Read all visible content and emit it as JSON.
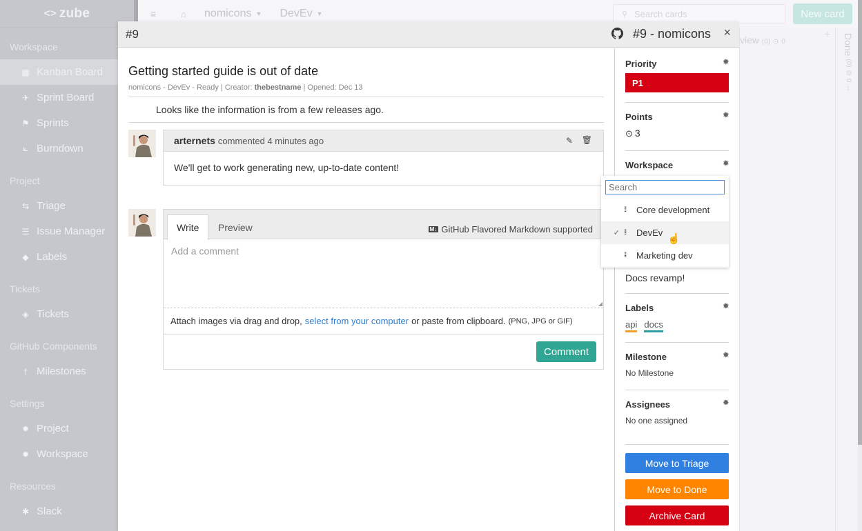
{
  "app": {
    "logo": "zube",
    "logo_icon": "code-brackets-icon"
  },
  "sidebar": {
    "sections": [
      {
        "title": "Workspace",
        "items": [
          {
            "label": "Kanban Board",
            "icon": "kanban-icon",
            "active": true
          },
          {
            "label": "Sprint Board",
            "icon": "runner-icon"
          },
          {
            "label": "Sprints",
            "icon": "flag-icon"
          },
          {
            "label": "Burndown",
            "icon": "chart-icon"
          }
        ]
      },
      {
        "title": "Project",
        "items": [
          {
            "label": "Triage",
            "icon": "triage-icon"
          },
          {
            "label": "Issue Manager",
            "icon": "list-icon"
          },
          {
            "label": "Labels",
            "icon": "tag-icon"
          }
        ]
      },
      {
        "title": "Tickets",
        "items": [
          {
            "label": "Tickets",
            "icon": "ticket-icon"
          }
        ]
      },
      {
        "title": "GitHub Components",
        "items": [
          {
            "label": "Milestones",
            "icon": "milestone-icon"
          }
        ]
      },
      {
        "title": "Settings",
        "items": [
          {
            "label": "Project",
            "icon": "gear-icon"
          },
          {
            "label": "Workspace",
            "icon": "gear-icon"
          }
        ]
      },
      {
        "title": "Resources",
        "items": [
          {
            "label": "Slack",
            "icon": "slack-icon"
          }
        ]
      }
    ]
  },
  "topbar": {
    "project": "nomicons",
    "workspace": "DevEv",
    "search_placeholder": "Search cards",
    "new_card": "New card"
  },
  "board": {
    "review_col": {
      "title": "view",
      "count": "(0)",
      "points": "0"
    },
    "done_col": {
      "title": "Done",
      "count": "(0)",
      "points": "0"
    }
  },
  "modal": {
    "id_label": "#9",
    "github_title": "#9 - nomicons",
    "close": "×",
    "card_title": "Getting started guide is out of date",
    "meta_prefix": "nomicons - DevEv - Ready | Creator: ",
    "meta_creator": "thebestname",
    "meta_suffix": " | Opened: Dec 13",
    "description": "Looks like the information is from a few releases ago.",
    "comment": {
      "author": "arternets",
      "action": "commented 4 minutes ago",
      "body": "We'll get to work generating new, up-to-date content!"
    },
    "new_comment": {
      "tab_write": "Write",
      "tab_preview": "Preview",
      "markdown_badge": "M↓",
      "markdown_note": "GitHub Flavored Markdown supported",
      "placeholder": "Add a comment",
      "attach_prefix": "Attach images via drag and drop,",
      "attach_link": "select from your computer",
      "attach_suffix": "or paste from clipboard.",
      "attach_types": "(PNG, JPG or GIF)",
      "submit": "Comment"
    }
  },
  "panel": {
    "priority": {
      "title": "Priority",
      "value": "P1",
      "color": "#d50012"
    },
    "points": {
      "title": "Points",
      "value": "3"
    },
    "workspace": {
      "title": "Workspace"
    },
    "epic": {
      "value": "Docs revamp!"
    },
    "labels": {
      "title": "Labels",
      "items": [
        {
          "name": "api",
          "color": "#f0a030"
        },
        {
          "name": "docs",
          "color": "#2f9ea3"
        }
      ]
    },
    "milestone": {
      "title": "Milestone",
      "value": "No Milestone"
    },
    "assignees": {
      "title": "Assignees",
      "value": "No one assigned"
    },
    "buttons": {
      "triage": {
        "label": "Move to Triage",
        "color": "#2f80e0"
      },
      "done": {
        "label": "Move to Done",
        "color": "#ff8400"
      },
      "archive": {
        "label": "Archive Card",
        "color": "#d50012"
      }
    }
  },
  "workspace_dropdown": {
    "search_placeholder": "Search",
    "options": [
      {
        "label": "Core development",
        "selected": false
      },
      {
        "label": "DevEv",
        "selected": true
      },
      {
        "label": "Marketing dev",
        "selected": false
      }
    ]
  }
}
